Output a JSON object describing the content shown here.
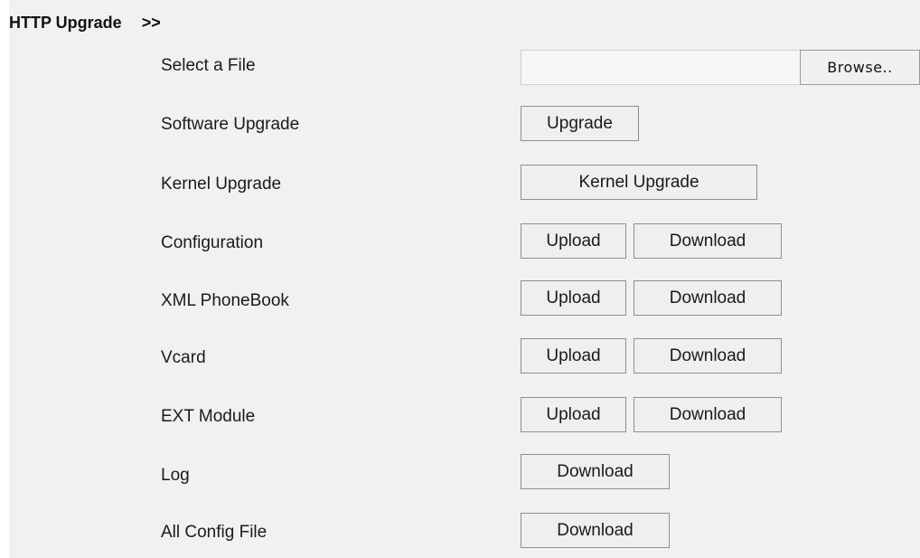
{
  "header": {
    "title": "HTTP Upgrade",
    "arrows": ">>"
  },
  "file_select": {
    "label": "Select a File",
    "browse_label": "Browse.."
  },
  "rows": {
    "software": {
      "label": "Software Upgrade",
      "upgrade_label": "Upgrade"
    },
    "kernel": {
      "label": "Kernel Upgrade",
      "upgrade_label": "Kernel Upgrade"
    },
    "configuration": {
      "label": "Configuration",
      "upload_label": "Upload",
      "download_label": "Download"
    },
    "xml_phonebook": {
      "label": "XML PhoneBook",
      "upload_label": "Upload",
      "download_label": "Download"
    },
    "vcard": {
      "label": "Vcard",
      "upload_label": "Upload",
      "download_label": "Download"
    },
    "ext_module": {
      "label": "EXT Module",
      "upload_label": "Upload",
      "download_label": "Download"
    },
    "log": {
      "label": "Log",
      "download_label": "Download"
    },
    "all_config": {
      "label": "All Config File",
      "download_label": "Download"
    }
  }
}
